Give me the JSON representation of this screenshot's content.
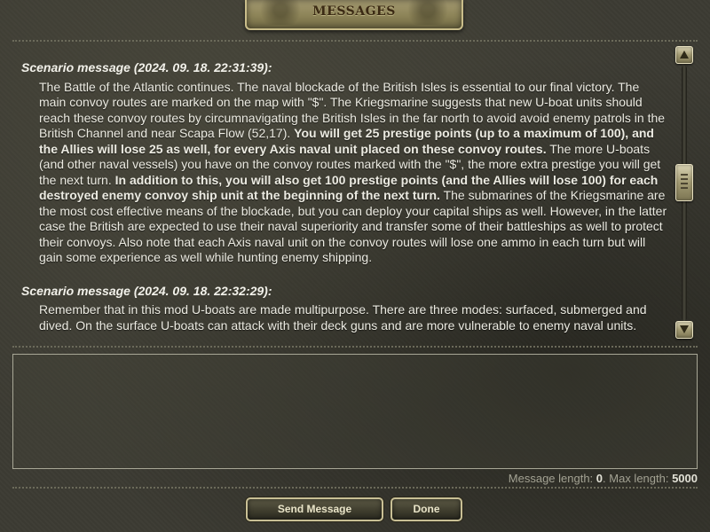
{
  "window": {
    "title": "MESSAGES"
  },
  "messages": [
    {
      "header": "Scenario message (2024. 09. 18. 22:31:39):",
      "segments": [
        {
          "text": "The Battle of the Atlantic continues. The naval blockade of the British Isles is essential to our final victory. The main convoy routes are marked on the map with \"$\". The Kriegsmarine suggests that new U-boat units should reach these convoy routes by circumnavigating the British Isles in the far north to avoid avoid enemy patrols in the British Channel and near Scapa Flow (52,17). ",
          "bold": false
        },
        {
          "text": "You will get 25 prestige points (up to a maximum of 100), and the Allies will lose 25 as well, for every Axis naval unit placed on these convoy routes.",
          "bold": true
        },
        {
          "text": " The more U-boats (and other naval vessels) you have on the convoy routes marked with the \"$\", the more extra prestige you will get the next turn. ",
          "bold": false
        },
        {
          "text": "In addition to this, you will also get 100 prestige points (and the Allies will lose 100) for each destroyed enemy convoy ship unit at the beginning of the next turn.",
          "bold": true
        },
        {
          "text": " The submarines of the Kriegsmarine are the most cost effective means of the blockade, but you can deploy your capital ships as well. However, in the latter case the British are expected to use their naval superiority and transfer some of their battleships as well to protect their convoys. Also note that each Axis naval unit on the convoy routes will lose one ammo in each turn but will gain some experience as well while hunting enemy shipping.",
          "bold": false
        }
      ]
    },
    {
      "header": "Scenario message (2024. 09. 18. 22:32:29):",
      "segments": [
        {
          "text": "Remember that in this mod U-boats are made multipurpose. There are three modes: surfaced, submerged and dived. On the surface U-boats can attack with their deck guns and are more vulnerable to enemy naval units.",
          "bold": false
        }
      ]
    }
  ],
  "scrollbar": {
    "up_icon": "arrow-up-icon",
    "down_icon": "arrow-down-icon",
    "position_fraction": 0.45
  },
  "compose": {
    "value": "",
    "placeholder": ""
  },
  "length": {
    "label_prefix": "Message length: ",
    "current": "0",
    "label_middle": ". Max length: ",
    "max": "5000"
  },
  "buttons": {
    "send_label": "Send Message",
    "done_label": "Done"
  },
  "colors": {
    "background": "#3c3b33",
    "text": "#ecebe2",
    "plaque": "#8d8458",
    "button_border": "#c8bf95"
  }
}
